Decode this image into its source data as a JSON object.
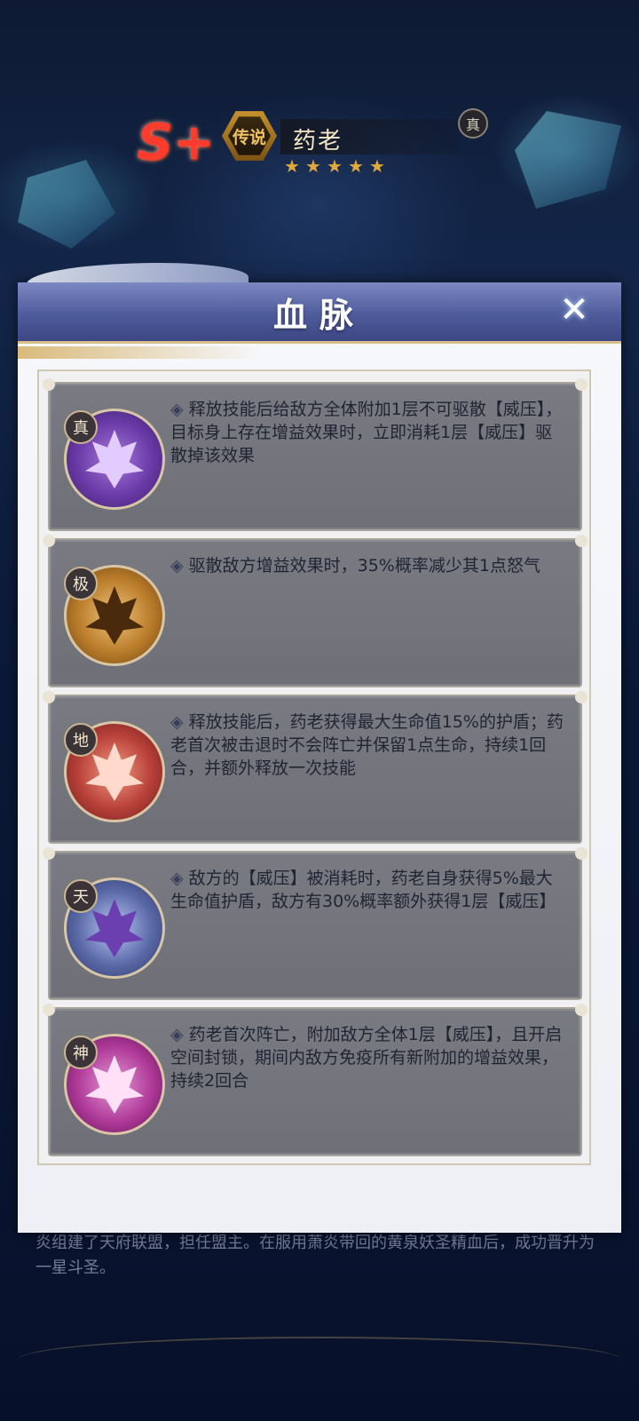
{
  "hero": {
    "rank": "S+",
    "rarity": "传说",
    "name": "药老",
    "star_icons": [
      "star-icon",
      "star-icon",
      "star-icon",
      "star-icon",
      "star-icon"
    ],
    "true_badge": "真"
  },
  "background_text": {
    "description": "炎组建了天府联盟，担任盟主。在服用萧炎带回的黄泉妖圣精血后，成功晋升为一星斗圣。"
  },
  "modal": {
    "title": "血脉",
    "close_icon": "close-icon",
    "bullet_icon": "◈",
    "entries": [
      {
        "tier": "真",
        "emblem_icon": "purple-flame-emblem",
        "emblem_color": "#6a3aa8",
        "text": "释放技能后给敌方全体附加1层不可驱散【威压】，目标身上存在增益效果时，立即消耗1层【威压】驱散掉该效果"
      },
      {
        "tier": "极",
        "emblem_icon": "gold-flame-emblem",
        "emblem_color": "#b97c2a",
        "text": "驱散敌方增益效果时，35%概率减少其1点怒气"
      },
      {
        "tier": "地",
        "emblem_icon": "red-flame-emblem",
        "emblem_color": "#b8403a",
        "text": "释放技能后，药老获得最大生命值15%的护盾；药老首次被击退时不会阵亡并保留1点生命，持续1回合，并额外释放一次技能"
      },
      {
        "tier": "天",
        "emblem_icon": "blue-flame-emblem",
        "emblem_color": "#5a6aa8",
        "text": "敌方的【威压】被消耗时，药老自身获得5%最大生命值护盾，敌方有30%概率额外获得1层【威压】"
      },
      {
        "tier": "神",
        "emblem_icon": "magenta-flame-emblem",
        "emblem_color": "#b03a9a",
        "text": "药老首次阵亡，附加敌方全体1层【威压】，且开启空间封锁，期间内敌方免疫所有新附加的增益效果，持续2回合"
      }
    ]
  },
  "colors": {
    "header_blue": "#4f5c9c",
    "card_gray": "#74747c",
    "gold_trim": "#d9c08a"
  }
}
